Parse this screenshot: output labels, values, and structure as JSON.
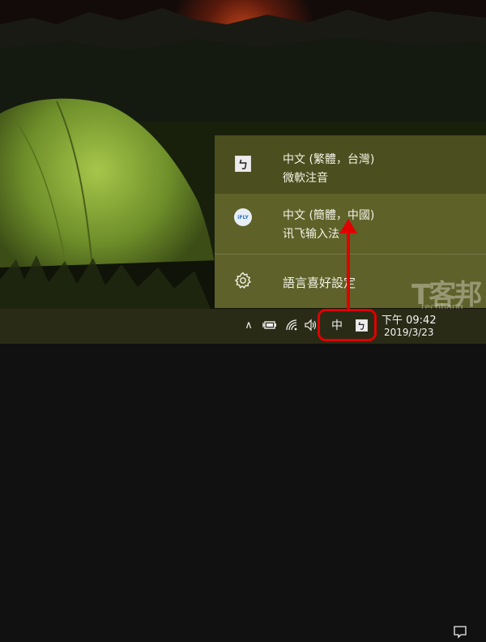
{
  "ime_menu": {
    "items": [
      {
        "icon": "keyboard-mode-icon",
        "mode_glyph": "ㄅ",
        "title": "中文 (繁體，台灣)",
        "subtitle": "微軟注音",
        "selected": true
      },
      {
        "icon": "iflytek-logo-icon",
        "logo_text": "iFLY",
        "title": "中文 (簡體，中國)",
        "subtitle": "讯飞输入法",
        "selected": false
      },
      {
        "icon": "gear-icon",
        "title": "語言喜好設定"
      }
    ]
  },
  "taskbar": {
    "tray_chevron": "∧",
    "ime_language": "中",
    "ime_mode": "ㄅ",
    "clock_time": "下午 09:42",
    "clock_date": "2019/3/23"
  },
  "watermark": {
    "text": "T客邦",
    "sub": "techbang"
  },
  "colors": {
    "menu_bg": "#64672c",
    "taskbar_bg": "#2a2b16",
    "highlight": "#e00000",
    "menu_text": "#f3f3e6"
  }
}
